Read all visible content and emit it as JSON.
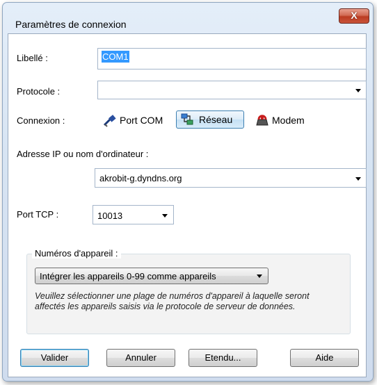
{
  "window": {
    "title": "Paramètres de connexion",
    "close_label": "X"
  },
  "libelle": {
    "label": "Libellé :",
    "value": "COM1"
  },
  "protocole": {
    "label": "Protocole :",
    "value": ""
  },
  "connexion": {
    "label": "Connexion :",
    "options": [
      {
        "label": "Port COM",
        "icon": "port-com-icon"
      },
      {
        "label": "Réseau",
        "icon": "network-icon",
        "selected": true
      },
      {
        "label": "Modem",
        "icon": "modem-icon"
      }
    ]
  },
  "adresse": {
    "label": "Adresse IP ou nom d'ordinateur :",
    "value": "akrobit-g.dyndns.org"
  },
  "port_tcp": {
    "label": "Port TCP :",
    "value": "10013"
  },
  "numeros": {
    "group_label": "Numéros d'appareil :",
    "selected": "Intégrer les appareils 0-99 comme appareils",
    "note": "Veuillez sélectionner une plage de numéros d'appareil à laquelle seront affectés les appareils saisis via le protocole de serveur de données."
  },
  "buttons": {
    "ok": "Valider",
    "cancel": "Annuler",
    "extended": "Etendu...",
    "help": "Aide"
  }
}
